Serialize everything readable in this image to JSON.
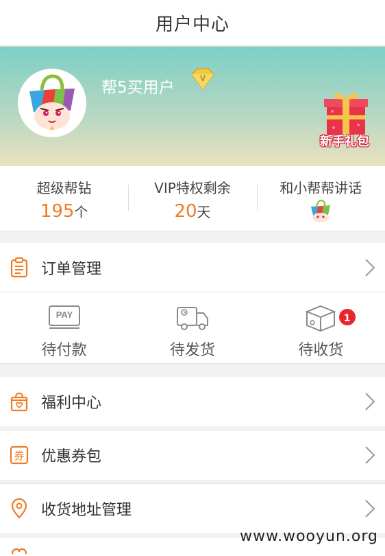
{
  "header": {
    "title": "用户中心"
  },
  "profile": {
    "username": "帮5买用户",
    "gift_label": "新手礼包"
  },
  "stats": [
    {
      "label": "超级帮钻",
      "value": "195",
      "unit": "个"
    },
    {
      "label": "VIP特权剩余",
      "value": "20",
      "unit": "天"
    },
    {
      "label": "和小帮帮讲话"
    }
  ],
  "orders": {
    "label": "订单管理",
    "sub": [
      {
        "label": "待付款",
        "icon_text": "PAY"
      },
      {
        "label": "待发货"
      },
      {
        "label": "待收货",
        "badge": "1"
      }
    ]
  },
  "menu": [
    {
      "label": "福利中心"
    },
    {
      "label": "优惠券包",
      "icon_text": "券"
    },
    {
      "label": "收货地址管理"
    }
  ],
  "watermark": "www.wooyun.org",
  "colors": {
    "accent": "#f07a22",
    "badge": "#e8262e",
    "hero_top": "#7ccfc6",
    "hero_bottom": "#ebe1bf"
  }
}
